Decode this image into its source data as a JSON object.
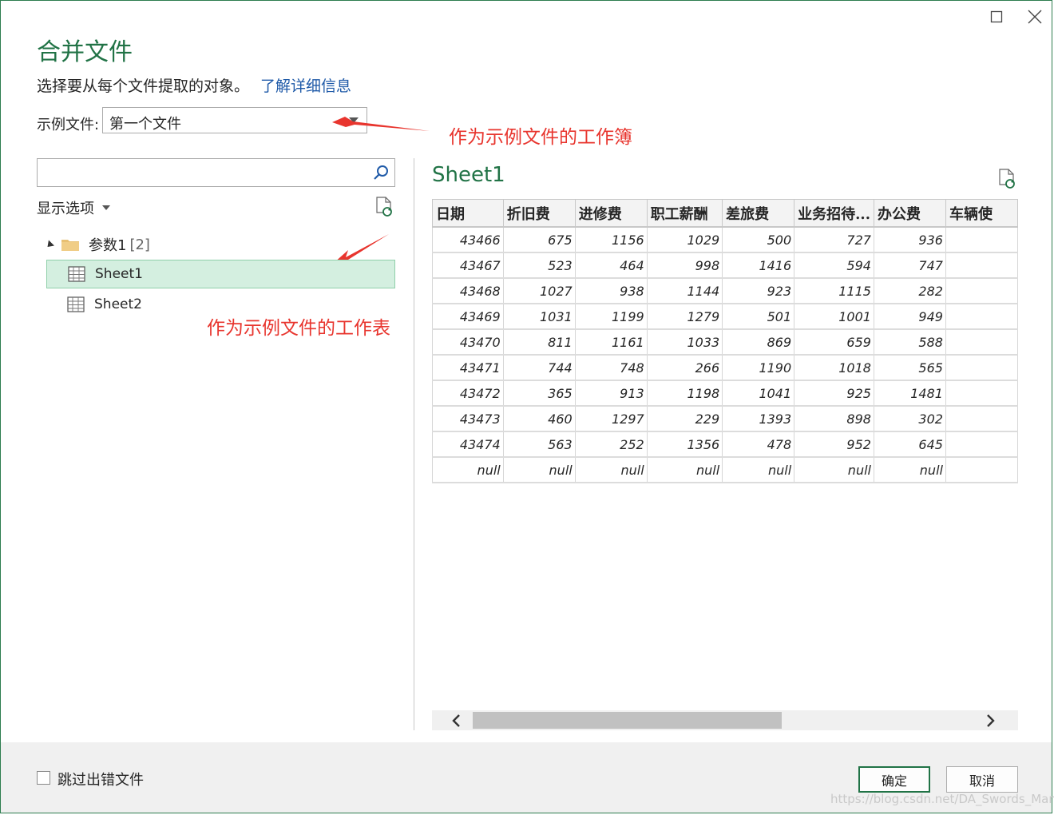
{
  "dialog": {
    "title": "合并文件",
    "subtitle": "选择要从每个文件提取的对象。",
    "learn_more": "了解详细信息"
  },
  "sample_file": {
    "label": "示例文件:",
    "value": "第一个文件"
  },
  "annotations": {
    "workbook": "作为示例文件的工作簿",
    "sheet": "作为示例文件的工作表",
    "color": "#e8352e"
  },
  "navigator": {
    "search_placeholder": "",
    "display_options": "显示选项",
    "root": {
      "label": "参数1",
      "count": "[2]"
    },
    "items": [
      {
        "label": "Sheet1",
        "selected": true
      },
      {
        "label": "Sheet2",
        "selected": false
      }
    ]
  },
  "preview": {
    "title": "Sheet1",
    "columns": [
      "日期",
      "折旧费",
      "进修费",
      "职工薪酬",
      "差旅费",
      "业务招待...",
      "办公费",
      "车辆使"
    ],
    "rows": [
      [
        "43466",
        "675",
        "1156",
        "1029",
        "500",
        "727",
        "936",
        ""
      ],
      [
        "43467",
        "523",
        "464",
        "998",
        "1416",
        "594",
        "747",
        ""
      ],
      [
        "43468",
        "1027",
        "938",
        "1144",
        "923",
        "1115",
        "282",
        ""
      ],
      [
        "43469",
        "1031",
        "1199",
        "1279",
        "501",
        "1001",
        "949",
        ""
      ],
      [
        "43470",
        "811",
        "1161",
        "1033",
        "869",
        "659",
        "588",
        ""
      ],
      [
        "43471",
        "744",
        "748",
        "266",
        "1190",
        "1018",
        "565",
        ""
      ],
      [
        "43472",
        "365",
        "913",
        "1198",
        "1041",
        "925",
        "1481",
        ""
      ],
      [
        "43473",
        "460",
        "1297",
        "229",
        "1393",
        "898",
        "302",
        ""
      ],
      [
        "43474",
        "563",
        "252",
        "1356",
        "478",
        "952",
        "645",
        ""
      ],
      [
        "null",
        "null",
        "null",
        "null",
        "null",
        "null",
        "null",
        ""
      ]
    ]
  },
  "footer": {
    "skip_errors": "跳过出错文件",
    "ok": "确定",
    "cancel": "取消",
    "watermark": "https://blog.csdn.net/DA_Swords_Man"
  },
  "colors": {
    "accent": "#217346",
    "selection": "#d4efe0",
    "link": "#1f5aa8"
  }
}
